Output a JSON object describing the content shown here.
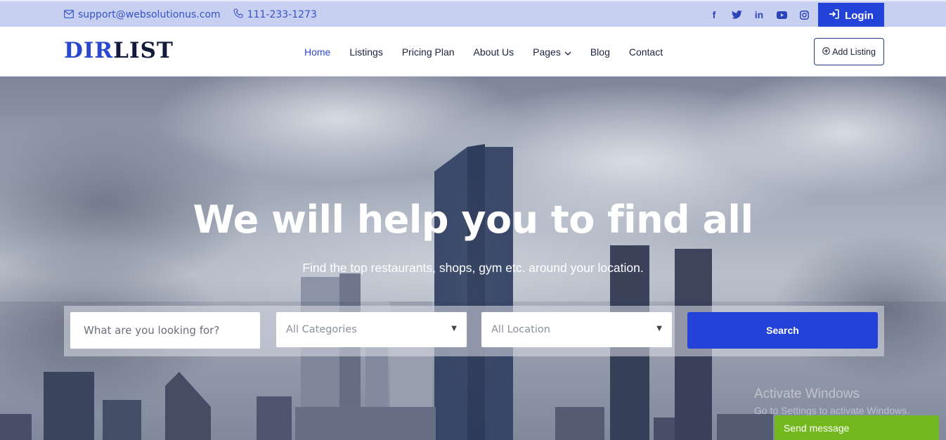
{
  "topbar": {
    "email": "support@websolutionus.com",
    "phone": "111-233-1273",
    "social": [
      "facebook-icon",
      "twitter-icon",
      "linkedin-icon",
      "youtube-icon",
      "instagram-icon"
    ],
    "login_label": "Login"
  },
  "navbar": {
    "logo_part1": "DIR",
    "logo_part2": "LIST",
    "menu": [
      {
        "label": "Home",
        "active": true
      },
      {
        "label": "Listings"
      },
      {
        "label": "Pricing Plan"
      },
      {
        "label": "About Us"
      },
      {
        "label": "Pages",
        "dropdown": true
      },
      {
        "label": "Blog"
      },
      {
        "label": "Contact"
      }
    ],
    "add_listing_label": "Add Listing"
  },
  "hero": {
    "title": "We will help you to find all",
    "subtitle": "Find the top restaurants, shops, gym etc. around your location.",
    "search": {
      "keyword_placeholder": "What are you looking for?",
      "category_selected": "All Categories",
      "location_selected": "All Location",
      "button_label": "Search"
    }
  },
  "watermark": {
    "line1": "Activate Windows",
    "line2": "Go to Settings to activate Windows."
  },
  "chat": {
    "label": "Send message"
  },
  "colors": {
    "accent": "#2342d8",
    "topbar_bg": "#c8d0f2",
    "chat_green": "#74b820"
  }
}
